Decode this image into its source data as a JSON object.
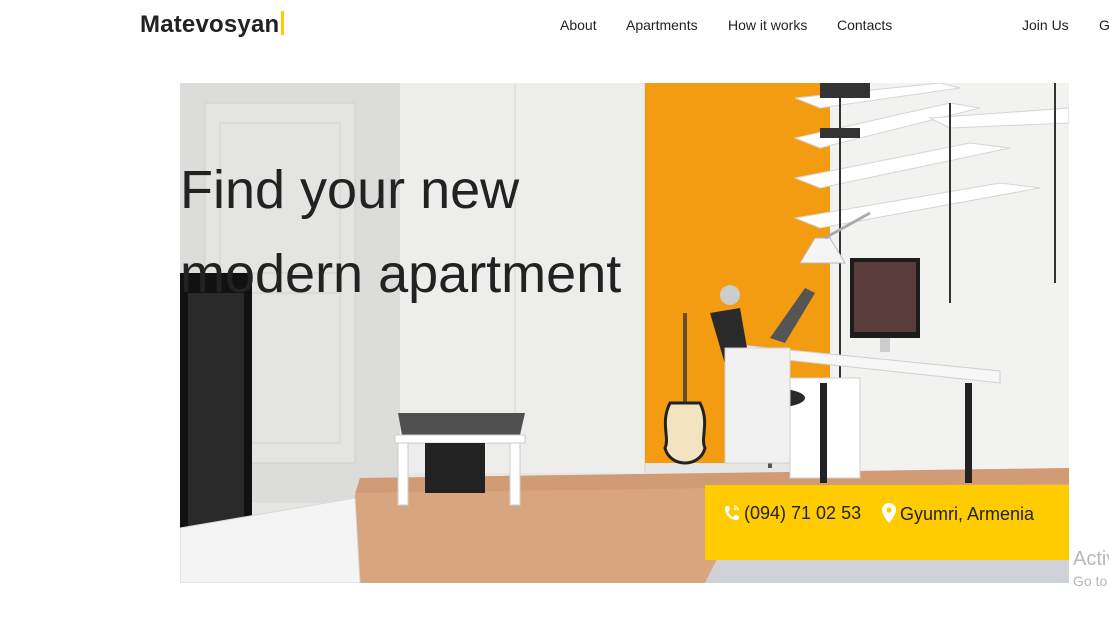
{
  "brand": {
    "name": "Matevosyan"
  },
  "nav": {
    "about": "About",
    "apartments": "Apartments",
    "how_it_works": "How it works",
    "contacts": "Contacts",
    "join_us": "Join Us",
    "cut_off": "G"
  },
  "hero": {
    "title_line1": "Find your new",
    "title_line2": "modern apartment"
  },
  "contact": {
    "phone": "(094) 71 02 53",
    "location": "Gyumri, Armenia"
  },
  "watermark": {
    "line1": "Activ",
    "line2": "Go to"
  },
  "colors": {
    "accent": "#ffcc00",
    "wall_orange": "#f39c12",
    "text": "#222222"
  }
}
